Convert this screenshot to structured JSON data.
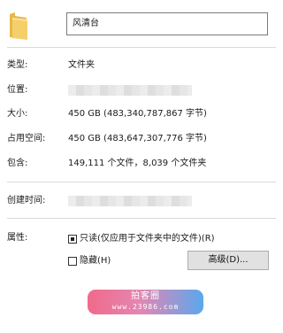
{
  "folder": {
    "name": "风清台",
    "icon": "folder-icon"
  },
  "properties": {
    "type_label": "类型:",
    "type_value": "文件夹",
    "location_label": "位置:",
    "size_label": "大小:",
    "size_value": "450 GB (483,340,787,867 字节)",
    "size_on_disk_label": "占用空间:",
    "size_on_disk_value": "450 GB (483,647,307,776 字节)",
    "contains_label": "包含:",
    "contains_value": "149,111 个文件，8,039 个文件夹",
    "created_label": "创建时间:"
  },
  "attributes": {
    "label": "属性:",
    "readonly_label": "只读(仅应用于文件夹中的文件)(R)",
    "readonly_state": "indeterminate",
    "hidden_label": "隐藏(H)",
    "hidden_state": "unchecked",
    "advanced_button": "高级(D)..."
  },
  "watermark": {
    "title": "拍客圈",
    "url": "www.23986.com"
  },
  "colors": {
    "folder_yellow": "#f2c75b",
    "separator": "#d9d9d9",
    "button_bg": "#e1e1e1"
  }
}
